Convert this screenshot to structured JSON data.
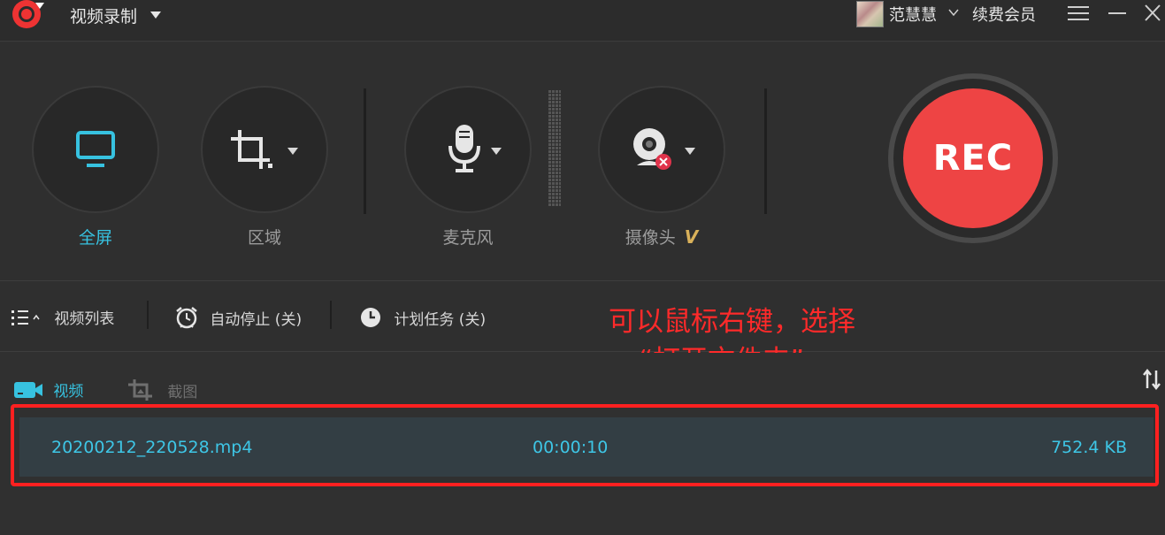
{
  "titlebar": {
    "app_title": "视频录制",
    "username": "范慧慧",
    "renew_label": "续费会员",
    "icons": [
      "logo-icon",
      "chevron-down-icon",
      "avatar",
      "menu-icon",
      "minimize-icon",
      "close-icon"
    ]
  },
  "controls": {
    "fullscreen_label": "全屏",
    "region_label": "区域",
    "mic_label": "麦克风",
    "camera_label": "摄像头",
    "vip_badge": "V",
    "rec_label": "REC",
    "colors": {
      "accent": "#37c2e0",
      "rec": "#ee4444",
      "vip": "#d9b15a"
    }
  },
  "toolbar": {
    "video_list_label": "视频列表",
    "auto_stop_label": "自动停止 (关)",
    "schedule_label": "计划任务 (关)"
  },
  "annotation": {
    "line1": "可以鼠标右键，选择",
    "line2": "“打开文件夹”",
    "color": "#ff2a2a"
  },
  "files": {
    "tab_video": "视频",
    "tab_screenshot": "截图",
    "rows": [
      {
        "name": "20200212_220528.mp4",
        "duration": "00:00:10",
        "size": "752.4 KB"
      }
    ]
  }
}
